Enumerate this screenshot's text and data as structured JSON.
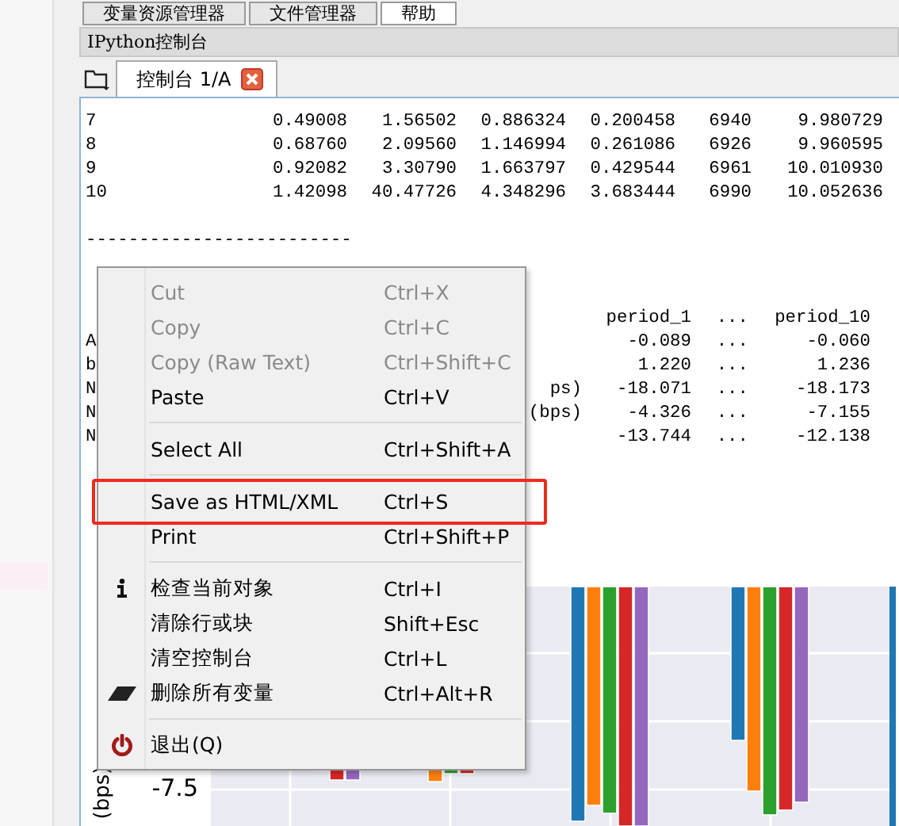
{
  "top_tabs": [
    {
      "label": "变量资源管理器",
      "selected": false
    },
    {
      "label": "文件管理器",
      "selected": false
    },
    {
      "label": "帮助",
      "selected": true
    }
  ],
  "pane": {
    "title": "IPython控制台"
  },
  "console_tabs": [
    {
      "label": "控制台 1/A",
      "selected": true
    }
  ],
  "console": {
    "rows": [
      [
        "7",
        "0.49008",
        "1.56502",
        "0.886324",
        "0.200458",
        "6940",
        "9.980729"
      ],
      [
        "8",
        "0.68760",
        "2.09560",
        "1.146994",
        "0.261086",
        "6926",
        "9.960595"
      ],
      [
        "9",
        "0.92082",
        "3.30790",
        "1.663797",
        "0.429544",
        "6961",
        "10.010930"
      ],
      [
        "10",
        "1.42098",
        "40.47726",
        "4.348296",
        "3.683444",
        "6990",
        "10.052636"
      ]
    ],
    "rule": "-------------------------",
    "summary_header": [
      "period_1",
      "...",
      "period_10"
    ],
    "summary_rows": [
      {
        "label": "A",
        "suffix": "",
        "values": [
          "-0.089",
          "...",
          "-0.060"
        ]
      },
      {
        "label": "b",
        "suffix": "",
        "values": [
          "1.220",
          "...",
          "1.236"
        ]
      },
      {
        "label": "N",
        "suffix": "ps)",
        "values": [
          "-18.071",
          "...",
          "-18.173"
        ]
      },
      {
        "label": "N",
        "suffix": "(bps)",
        "values": [
          "-4.326",
          "...",
          "-7.155"
        ]
      },
      {
        "label": "N",
        "suffix": "",
        "values": [
          "-13.744",
          "...",
          "-12.138"
        ]
      }
    ]
  },
  "chart": {
    "ylabel": "(bps)",
    "ytick": "-7.5"
  },
  "context_menu": [
    {
      "kind": "item",
      "label": "Cut",
      "shortcut": "Ctrl+X",
      "disabled": true,
      "highlighted": false
    },
    {
      "kind": "item",
      "label": "Copy",
      "shortcut": "Ctrl+C",
      "disabled": true,
      "highlighted": false
    },
    {
      "kind": "item",
      "label": "Copy (Raw Text)",
      "shortcut": "Ctrl+Shift+C",
      "disabled": true,
      "highlighted": false
    },
    {
      "kind": "item",
      "label": "Paste",
      "shortcut": "Ctrl+V",
      "disabled": false,
      "highlighted": false
    },
    {
      "kind": "separator"
    },
    {
      "kind": "item",
      "label": "Select All",
      "shortcut": "Ctrl+Shift+A",
      "disabled": false,
      "highlighted": false
    },
    {
      "kind": "separator"
    },
    {
      "kind": "item",
      "label": "Save as HTML/XML",
      "shortcut": "Ctrl+S",
      "disabled": false,
      "highlighted": true
    },
    {
      "kind": "item",
      "label": "Print",
      "shortcut": "Ctrl+Shift+P",
      "disabled": false,
      "highlighted": false
    },
    {
      "kind": "separator"
    },
    {
      "kind": "item",
      "label": "检查当前对象",
      "shortcut": "Ctrl+I",
      "disabled": false,
      "highlighted": false
    },
    {
      "kind": "item",
      "label": "清除行或块",
      "shortcut": "Shift+Esc",
      "disabled": false,
      "highlighted": false
    },
    {
      "kind": "item",
      "label": "清空控制台",
      "shortcut": "Ctrl+L",
      "disabled": false,
      "highlighted": false
    },
    {
      "kind": "item",
      "label": "删除所有变量",
      "shortcut": "Ctrl+Alt+R",
      "disabled": false,
      "highlighted": false
    },
    {
      "kind": "separator"
    },
    {
      "kind": "item",
      "label": "退出(Q)",
      "disabled": false,
      "highlighted": false
    }
  ]
}
